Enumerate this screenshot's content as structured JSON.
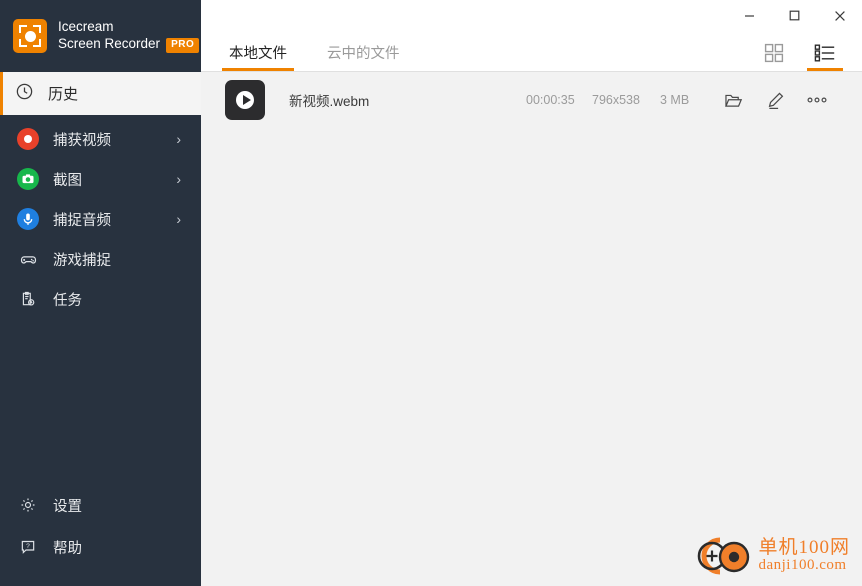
{
  "app": {
    "brand_line1": "Icecream",
    "brand_line2": "Screen Recorder",
    "pro_badge": "PRO",
    "logo_icon": "record-frame-icon"
  },
  "window_controls": {
    "minimize": "minimize-icon",
    "maximize": "maximize-icon",
    "close": "close-icon"
  },
  "sidebar": {
    "history": {
      "label": "历史",
      "icon": "clock-icon",
      "active": true
    },
    "items": [
      {
        "label": "捕获视频",
        "icon": "record-circle-icon",
        "color": "#e8412a",
        "chevron": "›"
      },
      {
        "label": "截图",
        "icon": "camera-icon",
        "color": "#17b74b",
        "chevron": "›"
      },
      {
        "label": "捕捉音频",
        "icon": "microphone-icon",
        "color": "#1f7fe0",
        "chevron": "›"
      },
      {
        "label": "游戏捕捉",
        "icon": "gamepad-icon",
        "color": "",
        "chevron": ""
      },
      {
        "label": "任务",
        "icon": "clipboard-clock-icon",
        "color": "",
        "chevron": ""
      }
    ],
    "bottom_items": [
      {
        "label": "设置",
        "icon": "gear-icon"
      },
      {
        "label": "帮助",
        "icon": "help-bubble-icon"
      }
    ]
  },
  "tabs": [
    {
      "label": "本地文件",
      "active": true
    },
    {
      "label": "云中的文件",
      "active": false
    }
  ],
  "view_toggle": {
    "grid": {
      "icon": "grid-view-icon",
      "active": false
    },
    "list": {
      "icon": "list-view-icon",
      "active": true
    }
  },
  "files": [
    {
      "name": "新视频.webm",
      "thumbnail_icon": "video-play-thumbnail",
      "duration": "00:00:35",
      "resolution": "796x538",
      "size": "3 MB",
      "actions": [
        {
          "icon": "open-folder-icon",
          "name": "open-folder-button"
        },
        {
          "icon": "pencil-edit-icon",
          "name": "edit-button"
        },
        {
          "icon": "more-dots-icon",
          "name": "more-options-button"
        }
      ]
    }
  ],
  "annotation": {
    "type": "red-arrow",
    "color": "#ef1111",
    "points_to": "open-folder-button"
  },
  "watermark": {
    "line1": "单机100网",
    "line2": "danji100.com",
    "color": "#f07f2a"
  },
  "colors": {
    "sidebar_bg": "#28323f",
    "accent": "#ef8200",
    "content_bg": "#f2f2f2",
    "header_bg": "#ffffff"
  }
}
